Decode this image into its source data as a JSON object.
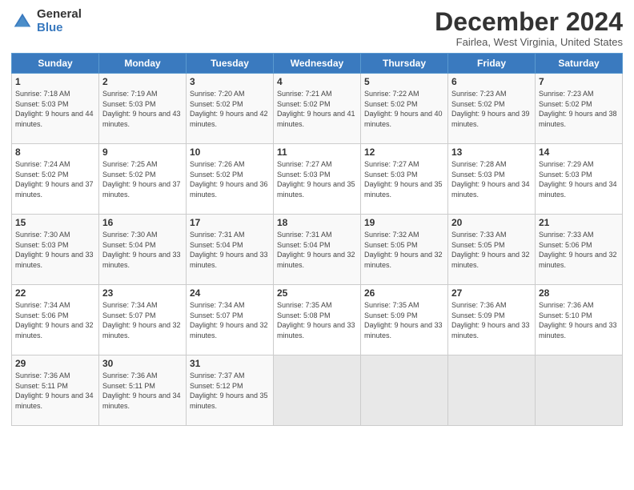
{
  "logo": {
    "general": "General",
    "blue": "Blue"
  },
  "title": "December 2024",
  "location": "Fairlea, West Virginia, United States",
  "days_header": [
    "Sunday",
    "Monday",
    "Tuesday",
    "Wednesday",
    "Thursday",
    "Friday",
    "Saturday"
  ],
  "weeks": [
    [
      {
        "day": "1",
        "sunrise": "7:18 AM",
        "sunset": "5:03 PM",
        "daylight": "9 hours and 44 minutes."
      },
      {
        "day": "2",
        "sunrise": "7:19 AM",
        "sunset": "5:03 PM",
        "daylight": "9 hours and 43 minutes."
      },
      {
        "day": "3",
        "sunrise": "7:20 AM",
        "sunset": "5:02 PM",
        "daylight": "9 hours and 42 minutes."
      },
      {
        "day": "4",
        "sunrise": "7:21 AM",
        "sunset": "5:02 PM",
        "daylight": "9 hours and 41 minutes."
      },
      {
        "day": "5",
        "sunrise": "7:22 AM",
        "sunset": "5:02 PM",
        "daylight": "9 hours and 40 minutes."
      },
      {
        "day": "6",
        "sunrise": "7:23 AM",
        "sunset": "5:02 PM",
        "daylight": "9 hours and 39 minutes."
      },
      {
        "day": "7",
        "sunrise": "7:23 AM",
        "sunset": "5:02 PM",
        "daylight": "9 hours and 38 minutes."
      }
    ],
    [
      {
        "day": "8",
        "sunrise": "7:24 AM",
        "sunset": "5:02 PM",
        "daylight": "9 hours and 37 minutes."
      },
      {
        "day": "9",
        "sunrise": "7:25 AM",
        "sunset": "5:02 PM",
        "daylight": "9 hours and 37 minutes."
      },
      {
        "day": "10",
        "sunrise": "7:26 AM",
        "sunset": "5:02 PM",
        "daylight": "9 hours and 36 minutes."
      },
      {
        "day": "11",
        "sunrise": "7:27 AM",
        "sunset": "5:03 PM",
        "daylight": "9 hours and 35 minutes."
      },
      {
        "day": "12",
        "sunrise": "7:27 AM",
        "sunset": "5:03 PM",
        "daylight": "9 hours and 35 minutes."
      },
      {
        "day": "13",
        "sunrise": "7:28 AM",
        "sunset": "5:03 PM",
        "daylight": "9 hours and 34 minutes."
      },
      {
        "day": "14",
        "sunrise": "7:29 AM",
        "sunset": "5:03 PM",
        "daylight": "9 hours and 34 minutes."
      }
    ],
    [
      {
        "day": "15",
        "sunrise": "7:30 AM",
        "sunset": "5:03 PM",
        "daylight": "9 hours and 33 minutes."
      },
      {
        "day": "16",
        "sunrise": "7:30 AM",
        "sunset": "5:04 PM",
        "daylight": "9 hours and 33 minutes."
      },
      {
        "day": "17",
        "sunrise": "7:31 AM",
        "sunset": "5:04 PM",
        "daylight": "9 hours and 33 minutes."
      },
      {
        "day": "18",
        "sunrise": "7:31 AM",
        "sunset": "5:04 PM",
        "daylight": "9 hours and 32 minutes."
      },
      {
        "day": "19",
        "sunrise": "7:32 AM",
        "sunset": "5:05 PM",
        "daylight": "9 hours and 32 minutes."
      },
      {
        "day": "20",
        "sunrise": "7:33 AM",
        "sunset": "5:05 PM",
        "daylight": "9 hours and 32 minutes."
      },
      {
        "day": "21",
        "sunrise": "7:33 AM",
        "sunset": "5:06 PM",
        "daylight": "9 hours and 32 minutes."
      }
    ],
    [
      {
        "day": "22",
        "sunrise": "7:34 AM",
        "sunset": "5:06 PM",
        "daylight": "9 hours and 32 minutes."
      },
      {
        "day": "23",
        "sunrise": "7:34 AM",
        "sunset": "5:07 PM",
        "daylight": "9 hours and 32 minutes."
      },
      {
        "day": "24",
        "sunrise": "7:34 AM",
        "sunset": "5:07 PM",
        "daylight": "9 hours and 32 minutes."
      },
      {
        "day": "25",
        "sunrise": "7:35 AM",
        "sunset": "5:08 PM",
        "daylight": "9 hours and 33 minutes."
      },
      {
        "day": "26",
        "sunrise": "7:35 AM",
        "sunset": "5:09 PM",
        "daylight": "9 hours and 33 minutes."
      },
      {
        "day": "27",
        "sunrise": "7:36 AM",
        "sunset": "5:09 PM",
        "daylight": "9 hours and 33 minutes."
      },
      {
        "day": "28",
        "sunrise": "7:36 AM",
        "sunset": "5:10 PM",
        "daylight": "9 hours and 33 minutes."
      }
    ],
    [
      {
        "day": "29",
        "sunrise": "7:36 AM",
        "sunset": "5:11 PM",
        "daylight": "9 hours and 34 minutes."
      },
      {
        "day": "30",
        "sunrise": "7:36 AM",
        "sunset": "5:11 PM",
        "daylight": "9 hours and 34 minutes."
      },
      {
        "day": "31",
        "sunrise": "7:37 AM",
        "sunset": "5:12 PM",
        "daylight": "9 hours and 35 minutes."
      },
      null,
      null,
      null,
      null
    ]
  ],
  "labels": {
    "sunrise": "Sunrise:",
    "sunset": "Sunset:",
    "daylight": "Daylight:"
  }
}
